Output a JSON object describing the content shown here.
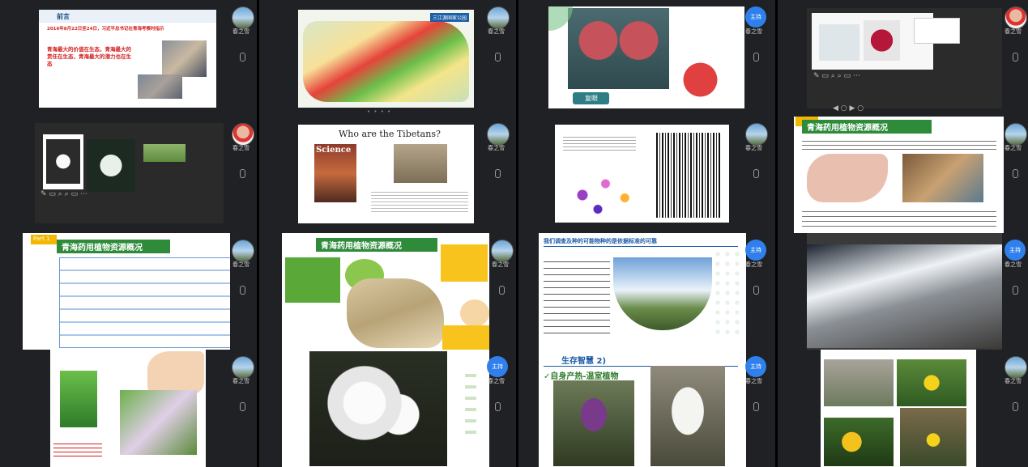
{
  "tiles": [
    {
      "user": "春之雪",
      "slide_title": "前言",
      "slide_subtitle": "2016年8月22日至24日，习近平总书记在青海考察时指示",
      "slide_body": "青海最大的价值在生态，青海最大的责任在生态，青海最大的潜力也在生态"
    },
    {
      "user": "春之雪",
      "slide_title": "三江源国家公园"
    },
    {
      "user": "春之雪",
      "caption": "复眼"
    },
    {
      "user": "春之雪"
    },
    {
      "user": "春之雪"
    },
    {
      "user": "春之雪",
      "slide_title": "Who are the Tibetans?",
      "journal": "Science"
    },
    {
      "user": "春之雪"
    },
    {
      "user": "春之雪",
      "slide_title": "青海药用植物资源概况"
    },
    {
      "user": "春之雪",
      "slide_title": "青海药用植物资源概况",
      "badge": "Part 1"
    },
    {
      "user": "春之雪",
      "slide_title": "青海药用植物资源概况"
    },
    {
      "user": "春之雪",
      "slide_title": "我们调查及种的可能物种的是依据标准的可靠"
    },
    {
      "user": "春之雪"
    },
    {
      "user": "春之雪"
    },
    {
      "user": "春之雪"
    },
    {
      "user": "春之雪",
      "slide_title": "生存智慧 2)",
      "subtitle": "✓自身产热-温室植物"
    },
    {
      "user": "春之雪"
    }
  ],
  "moderator_label": "主持"
}
